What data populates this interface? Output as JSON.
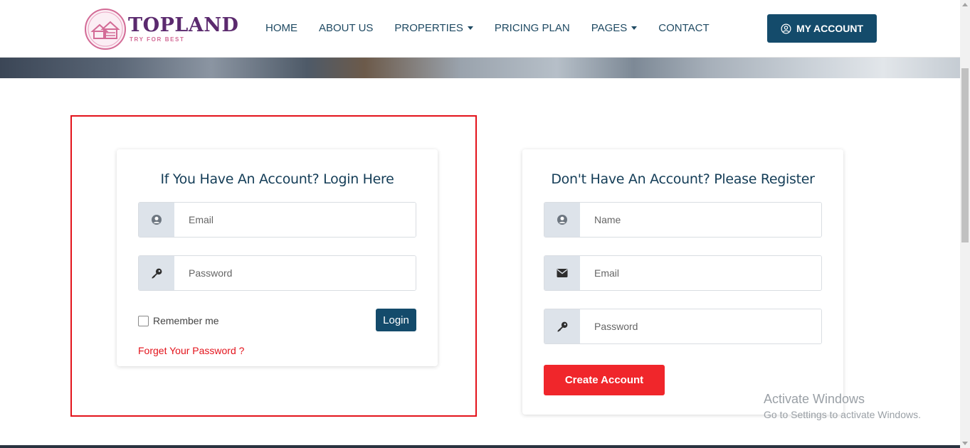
{
  "brand": {
    "name": "TOPLAND",
    "tagline": "TRY FOR BEST"
  },
  "nav": {
    "items": [
      {
        "label": "HOME",
        "dropdown": false
      },
      {
        "label": "ABOUT US",
        "dropdown": false
      },
      {
        "label": "PROPERTIES",
        "dropdown": true
      },
      {
        "label": "PRICING PLAN",
        "dropdown": false
      },
      {
        "label": "PAGES",
        "dropdown": true
      },
      {
        "label": "CONTACT",
        "dropdown": false
      }
    ],
    "account_label": "MY ACCOUNT"
  },
  "login": {
    "title": "If You Have An Account? Login Here",
    "email_placeholder": "Email",
    "password_placeholder": "Password",
    "remember_label": "Remember me",
    "login_label": "Login",
    "forgot_label": "Forget Your Password ?"
  },
  "register": {
    "title": "Don't Have An Account? Please Register",
    "name_placeholder": "Name",
    "email_placeholder": "Email",
    "password_placeholder": "Password",
    "create_label": "Create Account"
  },
  "watermark": {
    "title": "Activate Windows",
    "subtitle": "Go to Settings to activate Windows."
  },
  "colors": {
    "primary": "#144b6b",
    "accent_red": "#f0262b",
    "highlight_box": "#e3131b",
    "brand_purple": "#5b2a6e",
    "brand_pink": "#d36b96"
  },
  "icons": {
    "user": "user-circle-icon",
    "key": "key-icon",
    "envelope": "envelope-icon",
    "account": "user-outline-icon"
  }
}
